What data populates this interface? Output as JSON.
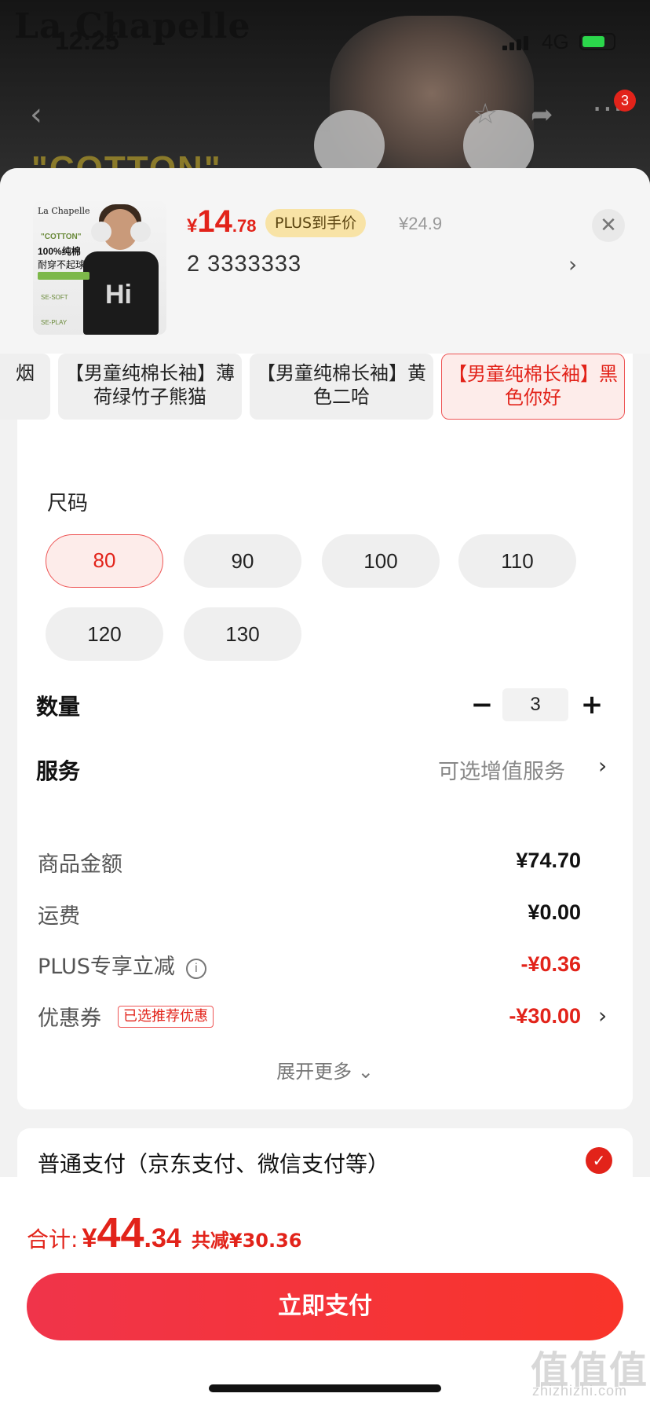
{
  "status_bar": {
    "time": "12:25",
    "network": "4G"
  },
  "backdrop": {
    "brand": "La Chapelle",
    "banner_text": "\"COTTON\"",
    "cart_badge": "3"
  },
  "product": {
    "thumb_brand": "La Chapelle",
    "thumb_cotton": "\"COTTON\"",
    "thumb_line1": "100%纯棉",
    "thumb_line2": "耐穿不起球",
    "thumb_feature1": "SE-SOFT",
    "thumb_feature2": "SE-PLAY",
    "thumb_print": "Hi",
    "price_symbol": "¥",
    "price_int": "14",
    "price_dec": ".78",
    "plus_tag": "PLUS到手价",
    "orig_price": "¥24.9",
    "selection": "2  3333333"
  },
  "colors": {
    "items": [
      {
        "label": "烟"
      },
      {
        "label": "【男童纯棉长袖】薄荷绿竹子熊猫"
      },
      {
        "label": "【男童纯棉长袖】黄色二哈"
      },
      {
        "label": "【男童纯棉长袖】黑色你好"
      }
    ],
    "selected_index": 3
  },
  "size": {
    "title": "尺码",
    "options": [
      "80",
      "90",
      "100",
      "110",
      "120",
      "130"
    ],
    "selected": "80"
  },
  "quantity": {
    "label": "数量",
    "value": "3",
    "minus": "−",
    "plus": "+"
  },
  "service": {
    "label": "服务",
    "hint": "可选增值服务"
  },
  "summary": {
    "goods_label": "商品金额",
    "goods_value": "¥74.70",
    "shipping_label": "运费",
    "shipping_value": "¥0.00",
    "plus_label": "PLUS专享立减",
    "plus_value": "-¥0.36",
    "coupon_label": "优惠券",
    "coupon_tag": "已选推荐优惠",
    "coupon_value": "-¥30.00",
    "expand": "展开更多"
  },
  "payment": {
    "method": "普通支付（京东支付、微信支付等）"
  },
  "total": {
    "label": "合计:",
    "symbol": "¥",
    "int": "44",
    "dec": ".34",
    "saved": "共减¥30.36"
  },
  "pay_button": "立即支付",
  "watermark": {
    "text": "值值值",
    "url": "zhizhizhi.com"
  },
  "icons": [
    "back-icon",
    "favorite-icon",
    "share-icon",
    "more-icon",
    "close-icon",
    "chevron-right-icon",
    "info-icon",
    "check-icon",
    "chevron-down-icon"
  ],
  "colors_theme": {
    "accent": "#e2231a",
    "plus_gold": "#f8e3a6",
    "selected_bg": "#fdecea"
  }
}
